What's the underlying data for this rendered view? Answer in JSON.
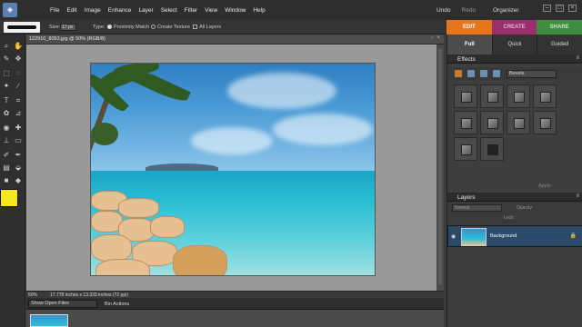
{
  "menubar": {
    "items": [
      "File",
      "Edit",
      "Image",
      "Enhance",
      "Layer",
      "Select",
      "Filter",
      "View",
      "Window",
      "Help"
    ],
    "undo": "Undo",
    "redo": "Redo",
    "organizer": "Organizer"
  },
  "options": {
    "size_label": "Size:",
    "size_value": "17 px",
    "type_label": "Type:",
    "proximity": "Proximity Match",
    "create_texture": "Create Texture",
    "all_layers": "All Layers"
  },
  "modes": [
    "EDIT",
    "CREATE",
    "SHARE"
  ],
  "document": {
    "title": "122910_8053.jpg @ 50% (RGB/8)",
    "zoom": "50%",
    "info": "17.778 inches x 13.333 inches (72 ppi)"
  },
  "bin": {
    "show": "Show Open Files",
    "actions": "Bin Actions"
  },
  "right": {
    "subtabs": [
      "Full",
      "Quick",
      "Guided"
    ],
    "effects_title": "Effects",
    "effects_dropdown": "Bevels",
    "apply": "Apply",
    "layers_title": "Layers",
    "blend_mode": "Normal",
    "opacity": "Opacity:",
    "lock": "Lock:",
    "layer_name": "Background"
  },
  "colors": {
    "edit_tab": "#e7751b",
    "create_tab": "#9a2f6d",
    "share_tab": "#3f8d3f",
    "foreground": "#f7e81c"
  }
}
